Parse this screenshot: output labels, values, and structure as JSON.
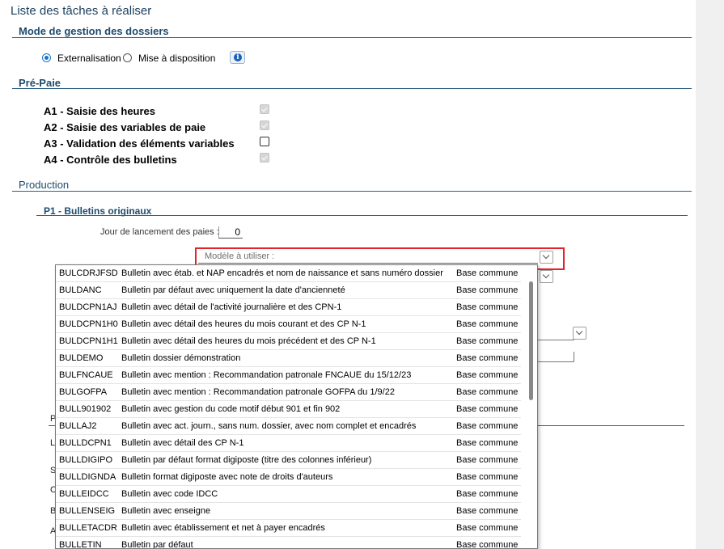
{
  "page_title": "Liste des tâches à réaliser",
  "mode": {
    "title": "Mode de gestion des dossiers",
    "options": [
      {
        "label": "Externalisation",
        "selected": true
      },
      {
        "label": "Mise à disposition",
        "selected": false
      }
    ],
    "info_icon": "info-icon"
  },
  "prepaie": {
    "title": "Pré-Paie",
    "tasks": [
      {
        "label": "A1 - Saisie des heures",
        "checked": true,
        "disabled": true
      },
      {
        "label": "A2 - Saisie des variables de paie",
        "checked": true,
        "disabled": true
      },
      {
        "label": "A3 - Validation des éléments variables",
        "checked": false,
        "disabled": false
      },
      {
        "label": "A4 - Contrôle des bulletins",
        "checked": true,
        "disabled": true
      }
    ]
  },
  "production": {
    "title": "Production",
    "p1_title": "P1 - Bulletins originaux",
    "jour_label": "Jour de lancement des paies :",
    "jour_value": "0",
    "modele_placeholder": "Modèle à utiliser :",
    "highlight_color": "#e0252b",
    "partial_fragments": [
      "P",
      "L",
      "S",
      "C",
      "B",
      "A"
    ]
  },
  "dropdown": {
    "rows": [
      {
        "code": "BULCDRJFSD",
        "desc": "Bulletin avec étab. et NAP encadrés et nom de naissance et sans numéro dossier",
        "base": "Base commune"
      },
      {
        "code": "BULDANC",
        "desc": "Bulletin par défaut avec uniquement la date d'ancienneté",
        "base": "Base commune"
      },
      {
        "code": "BULDCPN1AJ",
        "desc": "Bulletin avec détail de l'activité journalière et des CPN-1",
        "base": "Base commune"
      },
      {
        "code": "BULDCPN1H0",
        "desc": "Bulletin avec détail des heures du mois courant et des CP N-1",
        "base": "Base commune"
      },
      {
        "code": "BULDCPN1H1",
        "desc": "Bulletin avec détail des heures du mois précédent et des CP N-1",
        "base": "Base commune"
      },
      {
        "code": "BULDEMO",
        "desc": "Bulletin dossier démonstration",
        "base": "Base commune"
      },
      {
        "code": "BULFNCAUE",
        "desc": "Bulletin avec mention : Recommandation patronale FNCAUE du 15/12/23",
        "base": "Base commune"
      },
      {
        "code": "BULGOFPA",
        "desc": "Bulletin avec mention : Recommandation patronale GOFPA du 1/9/22",
        "base": "Base commune"
      },
      {
        "code": "BULL901902",
        "desc": "Bulletin avec gestion du code motif début 901 et fin 902",
        "base": "Base commune"
      },
      {
        "code": "BULLAJ2",
        "desc": "Bulletin avec act. journ., sans num. dossier, avec nom complet et encadrés",
        "base": "Base commune"
      },
      {
        "code": "BULLDCPN1",
        "desc": "Bulletin avec détail des CP N-1",
        "base": "Base commune"
      },
      {
        "code": "BULLDIGIPO",
        "desc": "Bulletin par défaut format digiposte (titre des colonnes inférieur)",
        "base": "Base commune"
      },
      {
        "code": "BULLDIGNDA",
        "desc": "Bulletin format digiposte avec note de droits d'auteurs",
        "base": "Base commune"
      },
      {
        "code": "BULLEIDCC",
        "desc": "Bulletin avec code IDCC",
        "base": "Base commune"
      },
      {
        "code": "BULLENSEIG",
        "desc": "Bulletin avec enseigne",
        "base": "Base commune"
      },
      {
        "code": "BULLETACDR",
        "desc": "Bulletin avec établissement et net à payer encadrés",
        "base": "Base commune"
      },
      {
        "code": "BULLETIN",
        "desc": "Bulletin par défaut",
        "base": "Base commune"
      }
    ]
  }
}
